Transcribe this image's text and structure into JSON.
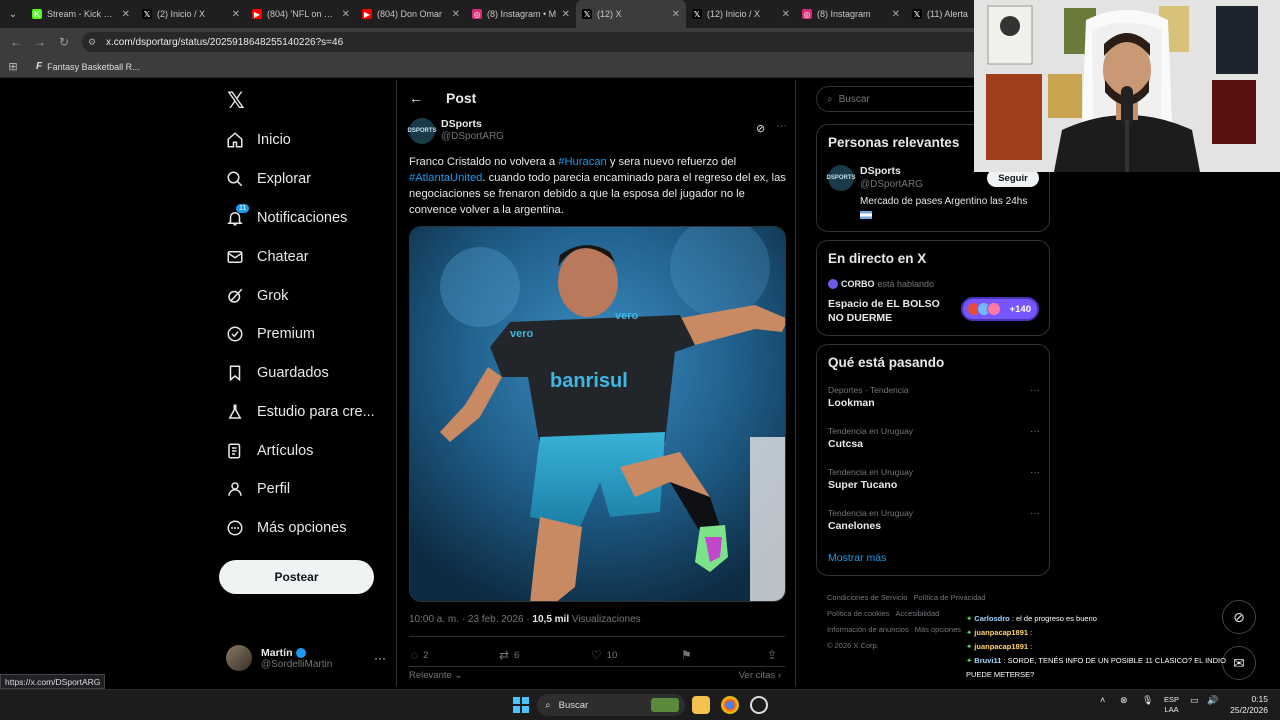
{
  "browser": {
    "tabs": [
      {
        "label": "Stream - Kick Dash",
        "fav_bg": "#53fc18",
        "fav_glyph": "K",
        "active": false
      },
      {
        "label": "(2) Inicio / X",
        "fav_bg": "#000000",
        "fav_glyph": "𝕏",
        "active": false
      },
      {
        "label": "(804) 'NFL on FOX'",
        "fav_bg": "#ff0000",
        "fav_glyph": "▶",
        "active": false
      },
      {
        "label": "(804) Don Omar",
        "fav_bg": "#ff0000",
        "fav_glyph": "▶",
        "active": false
      },
      {
        "label": "(8) Instagram • M",
        "fav_bg": "#d62976",
        "fav_glyph": "◎",
        "active": false
      },
      {
        "label": "(12) X",
        "fav_bg": "#000000",
        "fav_glyph": "𝕏",
        "active": true
      },
      {
        "label": "(12) Inicio / X",
        "fav_bg": "#000000",
        "fav_glyph": "𝕏",
        "active": false
      },
      {
        "label": "(8) Instagram",
        "fav_bg": "#d62976",
        "fav_glyph": "◎",
        "active": false
      },
      {
        "label": "(11) Alerta",
        "fav_bg": "#000000",
        "fav_glyph": "𝕏",
        "active": false
      }
    ],
    "url": "x.com/dsportarg/status/2025918648255140226?s=46",
    "bookmark": "Fantasy Basketball R...",
    "status_url": "https://x.com/DSportARG"
  },
  "nav": {
    "items": [
      {
        "label": "Inicio",
        "icon": "home-icon"
      },
      {
        "label": "Explorar",
        "icon": "search-icon"
      },
      {
        "label": "Notificaciones",
        "icon": "bell-icon",
        "badge": "11"
      },
      {
        "label": "Chatear",
        "icon": "mail-icon"
      },
      {
        "label": "Grok",
        "icon": "grok-icon"
      },
      {
        "label": "Premium",
        "icon": "premium-icon"
      },
      {
        "label": "Guardados",
        "icon": "bookmark-icon"
      },
      {
        "label": "Estudio para cre...",
        "icon": "flask-icon"
      },
      {
        "label": "Artículos",
        "icon": "article-icon"
      },
      {
        "label": "Perfil",
        "icon": "person-icon"
      },
      {
        "label": "Más opciones",
        "icon": "more-circle-icon"
      }
    ],
    "post_button": "Postear",
    "account": {
      "name": "Martín",
      "handle": "@SordelliMartin"
    }
  },
  "post": {
    "header_title": "Post",
    "author_name": "DSports",
    "author_handle": "@DSportARG",
    "avatar_text": "DSPORTS",
    "text_before_tag1": "Franco Cristaldo no volvera a ",
    "tag1": "#Huracan",
    "text_mid": " y sera nuevo refuerzo del ",
    "tag2": "#AtlantaUnited",
    "text_after": ". cuando todo parecia encaminado para el regreso del ex, las negociaciones se frenaron debido a que la esposa del jugador no le convence volver a la argentina.",
    "timestamp": "10:00 a. m. · 23 feb. 2026 · ",
    "views_count": "10,5 mil",
    "views_label": " Visualizaciones",
    "replies": "2",
    "reposts": "6",
    "likes": "10",
    "sort_label": "Relevante",
    "quotes_link": "Ver citas"
  },
  "right": {
    "search_placeholder": "Buscar",
    "relevant_title": "Personas relevantes",
    "relevant": {
      "name": "DSports",
      "handle": "@DSportARG",
      "follow": "Seguir",
      "bio": "Mercado de pases Argentino las 24hs"
    },
    "live_title": "En directo en X",
    "live": {
      "host": "CORBO",
      "host_status": "está hablando",
      "space_title": "Espacio de EL BOLSO NO DUERME",
      "count": "+140"
    },
    "trends_title": "Qué está pasando",
    "trends": [
      {
        "context": "Deportes · Tendencia",
        "name": "Lookman"
      },
      {
        "context": "Tendencia en Uruguay",
        "name": "Cutcsa"
      },
      {
        "context": "Tendencia en Uruguay",
        "name": "Super Tucano"
      },
      {
        "context": "Tendencia en Uruguay",
        "name": "Canelones"
      }
    ],
    "show_more": "Mostrar más",
    "footer": [
      "Condiciones de Servicio",
      "Política de Privacidad",
      "Política de cookies",
      "Accesibilidad",
      "Información de anuncios",
      "Más opciones",
      "© 2026 X Corp."
    ]
  },
  "chat": [
    {
      "user": "Carlosdro",
      "msg": ": el de progreso es bueno",
      "color": "u"
    },
    {
      "user": "juanpacap1891",
      "msg": ":",
      "color": "u2"
    },
    {
      "user": "juanpacap1891",
      "msg": ":",
      "color": "u2"
    },
    {
      "user": "Bruvi11",
      "msg": ": SORDE, TENÉS INFO DE UN POSIBLE 11 CLASICO? EL INDIO PUEDE METERSE?",
      "color": "u"
    }
  ],
  "taskbar": {
    "search_placeholder": "Buscar",
    "lang": "ESP",
    "lang2": "LAA",
    "time": "0:15",
    "date": "25/2/2026"
  },
  "colors": {
    "accent": "#1d9bf0",
    "bg": "#000000",
    "border": "#2f3336",
    "muted": "#71767b"
  }
}
